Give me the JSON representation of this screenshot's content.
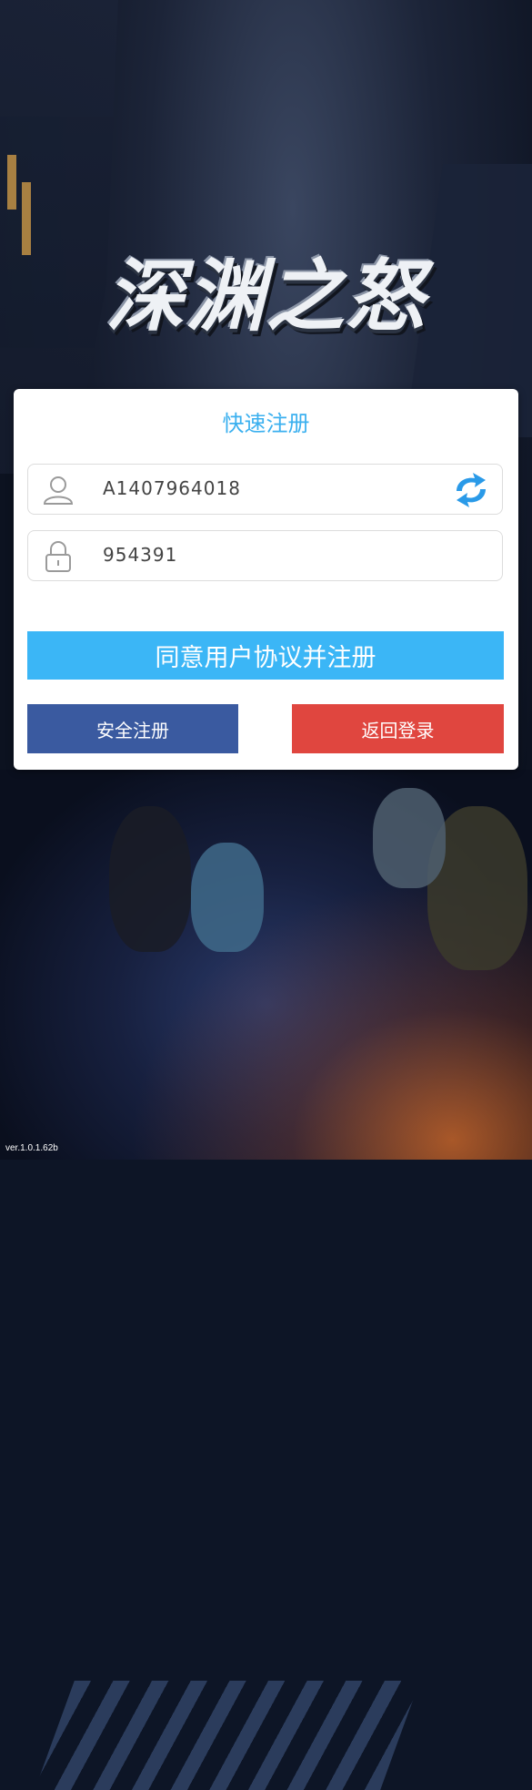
{
  "logo": {
    "text": "深渊之怒"
  },
  "register_panel": {
    "title": "快速注册",
    "account_field": {
      "value": "A1407964018",
      "icon": "user-icon",
      "action_icon": "refresh-icon"
    },
    "password_field": {
      "value": "954391",
      "icon": "lock-icon"
    },
    "agree_button": "同意用户协议并注册",
    "secure_register_button": "安全注册",
    "back_to_login_button": "返回登录"
  },
  "version": "ver.1.0.1.62b",
  "colors": {
    "accent_blue": "#3bb6f6",
    "title_blue": "#3bb0ef",
    "secure_button": "#3a5aa0",
    "back_button": "#e0463f"
  }
}
